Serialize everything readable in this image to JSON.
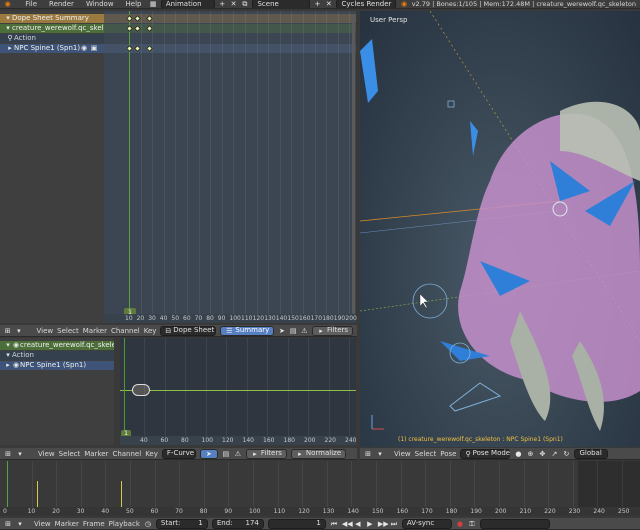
{
  "top_bar": {
    "menu": [
      "File",
      "Render",
      "Window",
      "Help"
    ],
    "layout_name": "Animation",
    "scene_name": "Scene",
    "engine": "Cycles Render",
    "stats": "v2.79 | Bones:1/105 | Mem:172.48M | creature_werewolf.qc_skeleton"
  },
  "dopesheet": {
    "channels": {
      "summary": "Dope Sheet Summary",
      "object": "creature_werewolf.qc_skeleton",
      "action": "Action",
      "bone": "NPC Spine1 (Spn1)"
    },
    "current_frame": "1",
    "ticks": [
      "10",
      "20",
      "30",
      "40",
      "50",
      "60",
      "70",
      "80",
      "90",
      "100",
      "110",
      "120",
      "130",
      "140",
      "150",
      "160",
      "170",
      "180",
      "190",
      "200"
    ],
    "header": {
      "menus": [
        "View",
        "Select",
        "Marker",
        "Channel",
        "Key"
      ],
      "mode": "Dope Sheet",
      "summary_btn": "Summary",
      "filters": "Filters"
    }
  },
  "graph": {
    "channels": {
      "object": "creature_werewolf.qc_skeleto",
      "action": "Action",
      "bone": "NPC Spine1 (Spn1)"
    },
    "current_frame": "1",
    "ticks": [
      "40",
      "60",
      "80",
      "100",
      "120",
      "140",
      "160",
      "180",
      "200",
      "220",
      "240"
    ],
    "header": {
      "menus": [
        "View",
        "Select",
        "Marker",
        "Channel",
        "Key"
      ],
      "mode": "F-Curve",
      "filters": "Filters",
      "normalize": "Normalize"
    }
  },
  "viewport": {
    "label": "User Persp",
    "status": "(1) creature_werewolf.qc_skeleton : NPC Spine1 (Spn1)",
    "header": {
      "menus": [
        "View",
        "Select",
        "Pose"
      ],
      "mode": "Pose Mode",
      "orientation": "Global"
    }
  },
  "timeline": {
    "ticks": [
      "0",
      "10",
      "20",
      "30",
      "40",
      "50",
      "60",
      "70",
      "80",
      "90",
      "100",
      "110",
      "120",
      "130",
      "140",
      "150",
      "160",
      "170",
      "180",
      "190",
      "200",
      "210",
      "220",
      "230",
      "240",
      "250"
    ],
    "header": {
      "menus": [
        "View",
        "Marker",
        "Frame",
        "Playback"
      ],
      "start_label": "Start:",
      "start_value": "1",
      "end_label": "End:",
      "end_value": "174",
      "current": "1",
      "sync": "AV-sync"
    }
  },
  "colors": {
    "selected_channel": "#5680c2",
    "keyframe": "#e8f5b0",
    "playhead": "#4e9a2e"
  }
}
